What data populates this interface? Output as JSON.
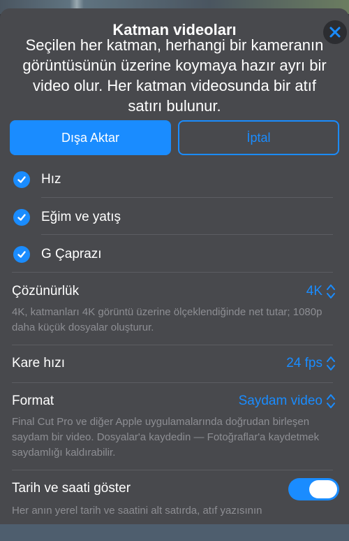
{
  "dialog": {
    "title": "Katman videoları",
    "subtitle": "Seçilen her katman, herhangi bir kameranın görüntüsünün üzerine koymaya hazır ayrı bir video olur. Her katman videosunda bir atıf satırı bulunur."
  },
  "actions": {
    "export_label": "Dışa Aktar",
    "cancel_label": "İptal"
  },
  "layers": [
    {
      "label": "Hız",
      "checked": true
    },
    {
      "label": "Eğim ve yatış",
      "checked": true
    },
    {
      "label": "G Çaprazı",
      "checked": true
    }
  ],
  "settings": {
    "resolution": {
      "label": "Çözünürlük",
      "value": "4K",
      "description": "4K, katmanları 4K görüntü üzerine ölçeklendiğinde net tutar; 1080p daha küçük dosyalar oluşturur."
    },
    "framerate": {
      "label": "Kare hızı",
      "value": "24 fps"
    },
    "format": {
      "label": "Format",
      "value": "Saydam video",
      "description": "Final Cut Pro ve diğer Apple uygulamalarında doğrudan birleşen saydam bir video. Dosyalar'a kaydedin — Fotoğraflar'a kaydetmek saydamlığı kaldırabilir."
    },
    "datetime": {
      "label": "Tarih ve saati göster",
      "enabled": true,
      "description": "Her anın yerel tarih ve saatini alt satırda, atıf yazısının"
    }
  },
  "colors": {
    "accent": "#1a8cff",
    "sheet": "#48494d",
    "muted_text": "#8d8e93"
  }
}
